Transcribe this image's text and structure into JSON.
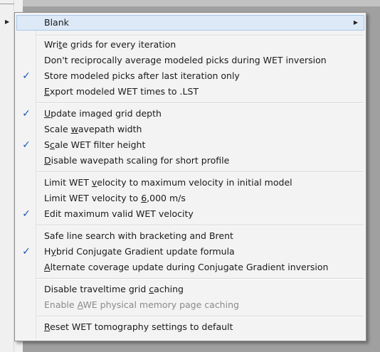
{
  "menu": {
    "blank": {
      "label": "Blank"
    },
    "items": [
      {
        "pre": "Wri",
        "acc": "t",
        "post": "e grids for every iteration",
        "checked": false,
        "enabled": true
      },
      {
        "pre": "Don't reciprocally average modeled picks during WET inversion",
        "acc": "",
        "post": "",
        "checked": false,
        "enabled": true
      },
      {
        "pre": "Store modeled picks after last iteration only",
        "acc": "",
        "post": "",
        "checked": true,
        "enabled": true
      },
      {
        "pre": "",
        "acc": "E",
        "post": "xport modeled WET times to .LST",
        "checked": false,
        "enabled": true
      },
      {
        "pre": "",
        "acc": "U",
        "post": "pdate imaged grid depth",
        "checked": true,
        "enabled": true
      },
      {
        "pre": "Scale ",
        "acc": "w",
        "post": "avepath width",
        "checked": false,
        "enabled": true
      },
      {
        "pre": "S",
        "acc": "c",
        "post": "ale WET filter height",
        "checked": true,
        "enabled": true
      },
      {
        "pre": "",
        "acc": "D",
        "post": "isable wavepath scaling for short profile",
        "checked": false,
        "enabled": true
      },
      {
        "pre": "Limit WET ",
        "acc": "v",
        "post": "elocity to maximum velocity in initial model",
        "checked": false,
        "enabled": true
      },
      {
        "pre": "Limit WET velocity to ",
        "acc": "6",
        "post": ",000 m/s",
        "checked": false,
        "enabled": true
      },
      {
        "pre": "Edit maximum valid WET velocity",
        "acc": "",
        "post": "",
        "checked": true,
        "enabled": true
      },
      {
        "pre": "Safe line search with bracketing and Brent",
        "acc": "",
        "post": "",
        "checked": false,
        "enabled": true
      },
      {
        "pre": "H",
        "acc": "y",
        "post": "brid Conjugate Gradient update formula",
        "checked": true,
        "enabled": true
      },
      {
        "pre": "",
        "acc": "A",
        "post": "lternate coverage update during Conjugate Gradient inversion",
        "checked": false,
        "enabled": true
      },
      {
        "pre": "Disable traveltime grid ",
        "acc": "c",
        "post": "aching",
        "checked": false,
        "enabled": true
      },
      {
        "pre": "Enable ",
        "acc": "A",
        "post": "WE physical memory page caching",
        "checked": false,
        "enabled": false
      },
      {
        "pre": "",
        "acc": "R",
        "post": "eset WET tomography settings to default",
        "checked": false,
        "enabled": true
      }
    ],
    "check_glyph": "✓",
    "submenu_glyph": "▶",
    "accent_color": "#1a56b8"
  }
}
